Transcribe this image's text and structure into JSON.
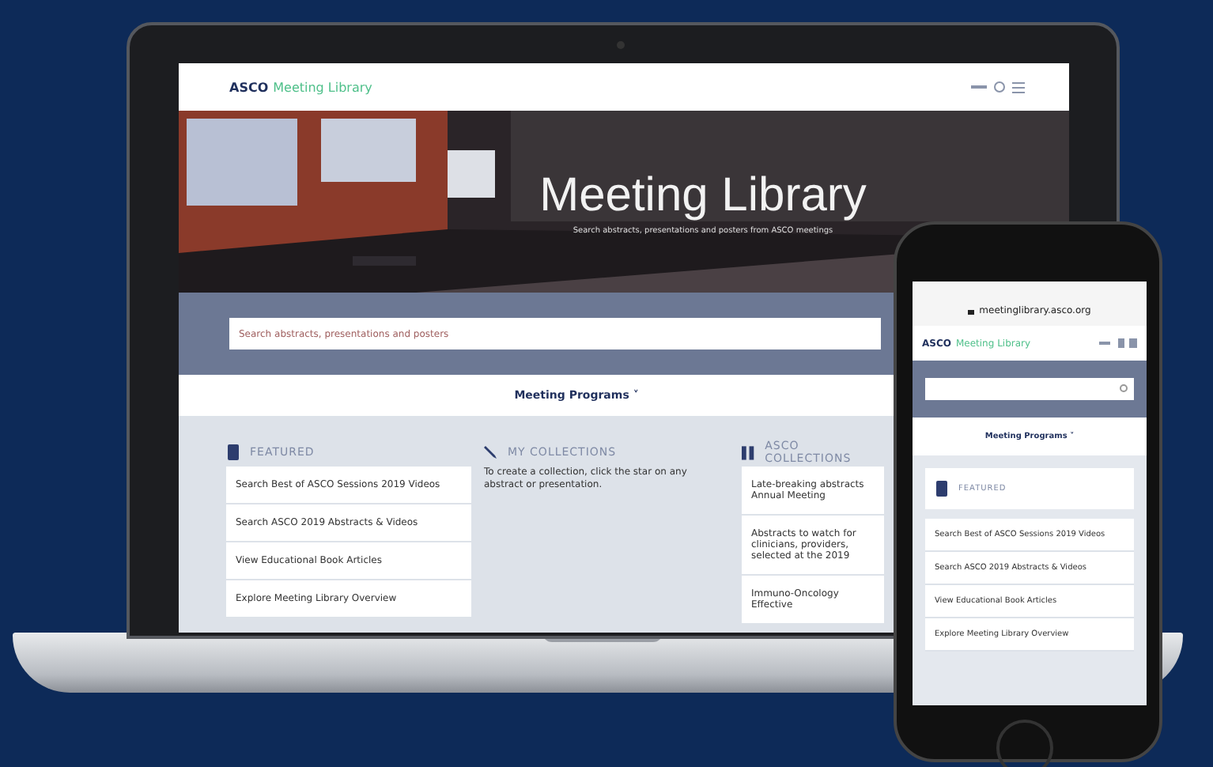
{
  "laptop": {
    "header": {
      "brand": "ASCO",
      "product": "Meeting Library"
    },
    "hero": {
      "title": "Meeting Library",
      "subtitle": "Search abstracts, presentations and posters from ASCO meetings"
    },
    "search": {
      "placeholder": "Search abstracts, presentations and posters"
    },
    "nav": {
      "label": "Meeting Programs",
      "caret": "˅"
    },
    "columns": [
      {
        "kind": "list",
        "heading": "FEATURED",
        "items": [
          "Search Best of ASCO Sessions 2019 Videos",
          "Search ASCO 2019 Abstracts & Videos",
          "View Educational Book Articles",
          "Explore Meeting Library Overview"
        ]
      },
      {
        "kind": "text",
        "heading": "MY COLLECTIONS",
        "text": "To create a collection, click the star on any abstract or presentation."
      },
      {
        "kind": "list",
        "heading": "ASCO COLLECTIONS",
        "items": [
          "Late-breaking abstracts Annual Meeting",
          "Abstracts to watch for clinicians, providers, selected at the 2019",
          "Immuno-Oncology Effective"
        ]
      }
    ]
  },
  "phone": {
    "url": "meetinglibrary.asco.org",
    "header": {
      "brand": "ASCO",
      "product": "Meeting Library"
    },
    "nav": {
      "label": "Meeting Programs",
      "caret": "˅"
    },
    "featured": {
      "heading": "FEATURED",
      "items": [
        "Search Best of ASCO Sessions 2019 Videos",
        "Search ASCO 2019 Abstracts & Videos",
        "View Educational Book Articles",
        "Explore Meeting Library Overview"
      ]
    }
  }
}
